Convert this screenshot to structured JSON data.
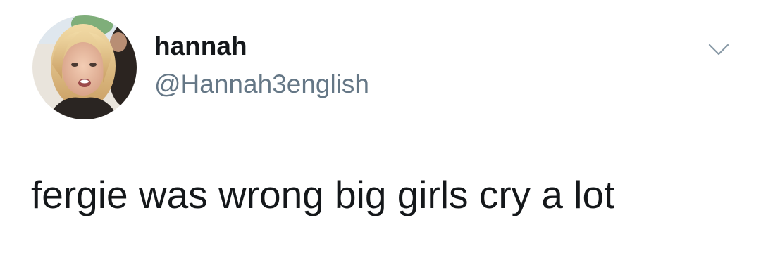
{
  "tweet": {
    "author": {
      "display_name": "hannah",
      "handle": "@Hannah3english",
      "avatar_icon": "profile-photo"
    },
    "text": "fergie was wrong big girls cry a lot",
    "menu_icon": "chevron-down-icon"
  }
}
